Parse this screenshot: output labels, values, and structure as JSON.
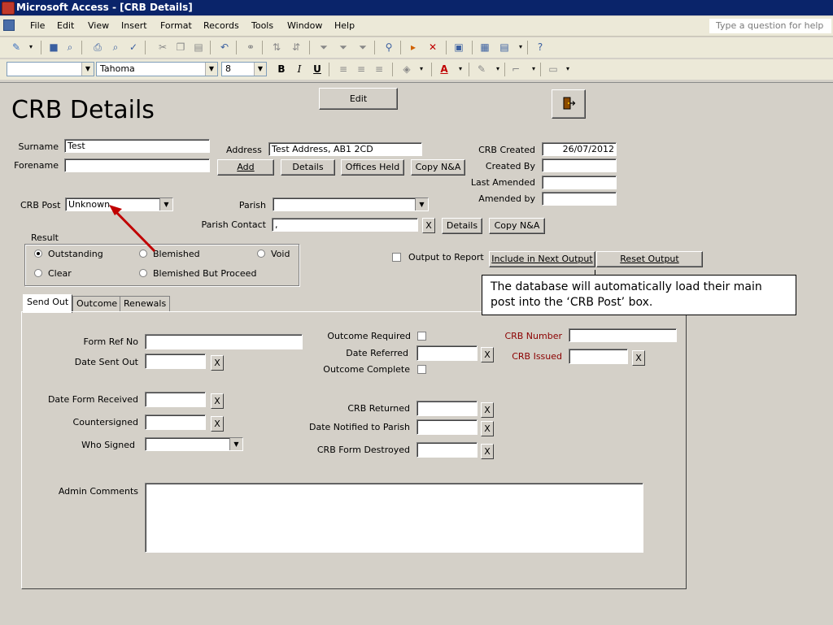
{
  "window": {
    "title": "Microsoft Access - [CRB Details]"
  },
  "menu": {
    "items": [
      "File",
      "Edit",
      "View",
      "Insert",
      "Format",
      "Records",
      "Tools",
      "Window",
      "Help"
    ],
    "help_placeholder": "Type a question for help"
  },
  "format_toolbar": {
    "object_combo": "",
    "font": "Tahoma",
    "size": "8"
  },
  "form": {
    "title": "CRB Details",
    "edit_button": "Edit",
    "surname_label": "Surname",
    "surname_value": "Test",
    "forename_label": "Forename",
    "forename_value": "",
    "address_label": "Address",
    "address_value": "Test Address, AB1 2CD",
    "add_button": "Add",
    "details_button": "Details",
    "offices_held_button": "Offices Held",
    "copy_na_button": "Copy N&A",
    "crb_created_label": "CRB Created",
    "crb_created_value": "26/07/2012",
    "created_by_label": "Created By",
    "created_by_value": "",
    "last_amended_label": "Last Amended",
    "last_amended_value": "",
    "amended_by_label": "Amended by",
    "amended_by_value": "",
    "crb_post_label": "CRB Post",
    "crb_post_value": "Unknown",
    "parish_label": "Parish",
    "parish_value": "",
    "parish_contact_label": "Parish Contact",
    "parish_contact_value": ",",
    "parish_contact_x": "X",
    "parish_details_button": "Details",
    "parish_copy_na_button": "Copy N&A",
    "result_label": "Result",
    "result_options": [
      {
        "label": "Outstanding",
        "selected": true
      },
      {
        "label": "Blemished",
        "selected": false
      },
      {
        "label": "Void",
        "selected": false
      },
      {
        "label": "Clear",
        "selected": false
      },
      {
        "label": "Blemished But Proceed",
        "selected": false
      }
    ],
    "output_to_report_label": "Output to Report",
    "include_next_output_button": "Include in Next Output",
    "reset_output_button": "Reset Output",
    "tabs": [
      "Send Out",
      "Outcome",
      "Renewals"
    ],
    "send_out": {
      "form_ref_no_label": "Form Ref No",
      "date_sent_out_label": "Date Sent Out",
      "date_form_received_label": "Date Form Received",
      "countersigned_label": "Countersigned",
      "who_signed_label": "Who Signed",
      "admin_comments_label": "Admin Comments",
      "outcome_required_label": "Outcome Required",
      "date_referred_label": "Date Referred",
      "outcome_complete_label": "Outcome Complete",
      "crb_returned_label": "CRB Returned",
      "date_notified_label": "Date Notified to Parish",
      "crb_form_destroyed_label": "CRB Form Destroyed",
      "crb_number_label": "CRB Number",
      "crb_issued_label": "CRB Issued",
      "x": "X"
    }
  },
  "callout": {
    "text": "The database will automatically load their main post into the ‘CRB Post’ box."
  }
}
